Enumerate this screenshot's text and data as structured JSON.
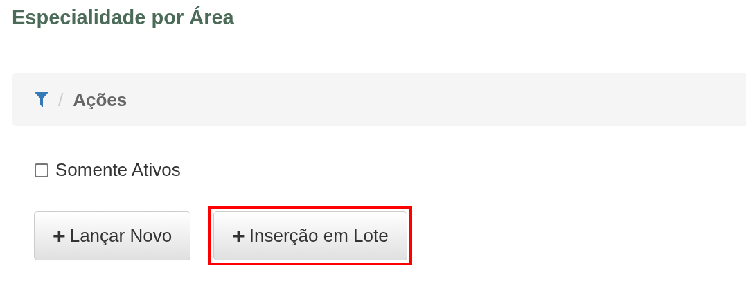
{
  "page_title": "Especialidade por Área",
  "breadcrumb": {
    "items": [
      "/",
      "Ações"
    ]
  },
  "filter": {
    "label": "Somente Ativos",
    "checked": false
  },
  "buttons": [
    {
      "icon": "+",
      "label": "Lançar Novo",
      "highlighted": false
    },
    {
      "icon": "+",
      "label": "Inserção em Lote",
      "highlighted": true
    }
  ]
}
